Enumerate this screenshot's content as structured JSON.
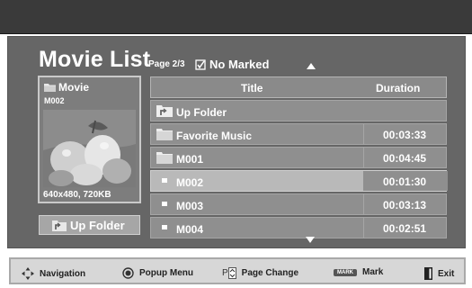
{
  "header": {
    "title": "Movie List",
    "page_info": "Page 2/3",
    "marked_status": "No Marked"
  },
  "preview": {
    "folder_label": "Movie",
    "item_name": "M002",
    "resolution": "640x480, 720KB",
    "up_folder_button": "Up Folder"
  },
  "list": {
    "columns": {
      "title": "Title",
      "duration": "Duration"
    },
    "rows": [
      {
        "type": "up-folder",
        "name": "Up Folder",
        "duration": ""
      },
      {
        "type": "folder",
        "name": "Favorite Music",
        "duration": "00:03:33"
      },
      {
        "type": "folder",
        "name": "M001",
        "duration": "00:04:45"
      },
      {
        "type": "file",
        "name": "M002",
        "duration": "00:01:30",
        "selected": true
      },
      {
        "type": "file",
        "name": "M003",
        "duration": "00:03:13"
      },
      {
        "type": "file",
        "name": "M004",
        "duration": "00:02:51"
      }
    ]
  },
  "footer": {
    "navigation": "Navigation",
    "popup_menu": "Popup Menu",
    "page_key": "P",
    "page_change": "Page Change",
    "mark_key": "MARK",
    "mark": "Mark",
    "exit": "Exit"
  }
}
